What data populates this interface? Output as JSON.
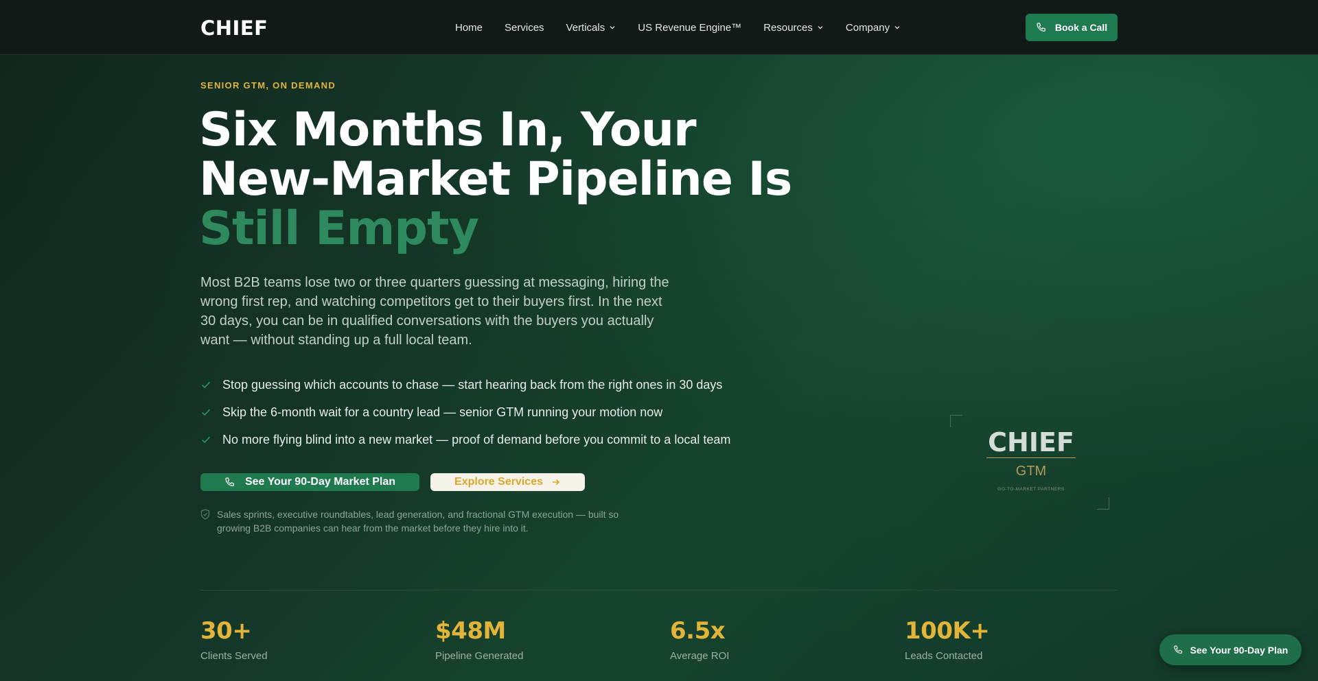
{
  "brand": {
    "logo": "CHIEF"
  },
  "nav": {
    "items": [
      {
        "label": "Home",
        "dropdown": false
      },
      {
        "label": "Services",
        "dropdown": false
      },
      {
        "label": "Verticals",
        "dropdown": true
      },
      {
        "label": "US Revenue Engine™",
        "dropdown": false
      },
      {
        "label": "Resources",
        "dropdown": true
      },
      {
        "label": "Company",
        "dropdown": true
      }
    ],
    "cta_label": "Book a Call"
  },
  "hero": {
    "eyebrow": "SENIOR GTM, ON DEMAND",
    "headline_main": "Six Months In, Your New-Market Pipeline Is ",
    "headline_accent": "Still Empty",
    "subtext": "Most B2B teams lose two or three quarters guessing at messaging, hiring the wrong first rep, and watching competitors get to their buyers first. In the next 30 days, you can be in qualified conversations with the buyers you actually want — without standing up a full local team.",
    "benefits": [
      "Stop guessing which accounts to chase — start hearing back from the right ones in 30 days",
      "Skip the 6-month wait for a country lead — senior GTM running your motion now",
      "No more flying blind into a new market — proof of demand before you commit to a local team"
    ],
    "cta_primary": "See Your 90-Day Market Plan",
    "cta_secondary": "Explore Services",
    "trust_note": "Sales sprints, executive roundtables, lead generation, and fractional GTM execution — built so growing B2B companies can hear from the market before they hire into it."
  },
  "logo_card": {
    "mark": "CHIEF",
    "sub": "GTM",
    "tagline": "GO-TO-MARKET PARTNERS"
  },
  "stats": [
    {
      "value": "30+",
      "label": "Clients Served"
    },
    {
      "value": "$48M",
      "label": "Pipeline Generated"
    },
    {
      "value": "6.5x",
      "label": "Average ROI"
    },
    {
      "value": "100K+",
      "label": "Leads Contacted"
    }
  ],
  "floating_cta": "See Your 90-Day Plan",
  "colors": {
    "accent_green": "#1f7a4f",
    "headline_green": "#2e8a5e",
    "gold": "#e1b53e",
    "nav_bg": "#121a17"
  }
}
